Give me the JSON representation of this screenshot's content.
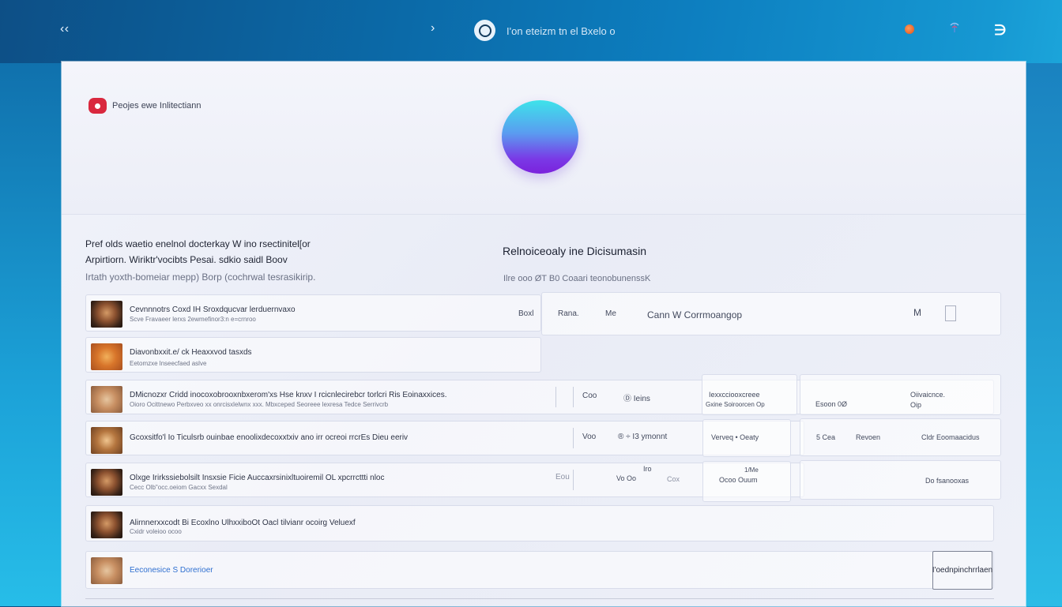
{
  "topbar": {
    "back_label": "‹ ‹",
    "forward_label": "›",
    "title": "I'on eteizm tn el Bxelo o",
    "menu_label": "∋"
  },
  "brand": {
    "name": "Peojes ewe Inlitectiann"
  },
  "intro": {
    "line1": "Pref olds waetio enelnol docterkay W ino rsectinitel[or",
    "line2": "Arpirtiorn. Wiriktr'vocibts Pesai. sdkio saidl Boov",
    "line3": "Irtath yoxth-bomeiar mepp) Borp (cochrwal tesrasikirip."
  },
  "section": {
    "title": "Relnoiceoaly ine Dicisumasin",
    "subtitle": "Ilre ooo ØT B0 Coaari teonobunenssK"
  },
  "rows": [
    {
      "title": "Cevnnnotrs Coxd IH Sroxdqucvar lerduernvaxo",
      "subtitle": "Scve Fravaeer lerxs 2ewmefinor3:n e=crnroo",
      "mid1": "Boxl",
      "mid2": "Rana.",
      "mid3": "Me",
      "mid4": "Cann  W Corrmoangop",
      "right": "M"
    },
    {
      "title": "Diavonbxxit.e/ ck Heaxxvod tasxds",
      "subtitle": "Eetomzxe lnseecfaed aslve"
    },
    {
      "title": "DMicnozxr Cridd inocoxobrooxnbxerom'xs Hse knxv I rcicnlecirebcr torlcri Ris Eoinaxxices.",
      "subtitle": "Oioro Ocittnewo Perbxveo xx onrcisxlelwnx xxx. Mbxceped Seoreee lexresa Tedce Serrivcrb",
      "mid1": "Coo",
      "mid2": "Ⓓ Ieins",
      "panel1_a": "Iexxcciooxcreee",
      "panel1_b": "Gxine Soiroorcen Op",
      "panel2_a": "Esoon 0Ø",
      "panel2_b": "Oiivaicnce.",
      "panel2_c": "Oip"
    },
    {
      "title": "Gcoxsitfo'l Io Ticulsrb ouinbae enoolixdecoxxtxiv ano irr ocreoi rrcrEs Dieu eeriv",
      "mid1": "Voo",
      "mid2": "® ÷  I3  ymonnt",
      "panel1": "Verveq  •  Oeaty",
      "panel2_a": "5  Cea",
      "panel2_b": "Revoen",
      "panel2_c": "Cldr Eoomaacidus"
    },
    {
      "title": "Olxge Irirkssiebolsilt Insxsie  Ficie Auccaxrsinixltuoiremil OL xpcrrcttti nloc",
      "subtitle": "Cecc Olb\"occ.oeiom Gacxx Sexdal",
      "mid1": "Eou",
      "mid2": "Iro",
      "mid3": "Vo  Oo",
      "mid4": "Cox",
      "panel1_a": "1/Me",
      "panel1_b": "Ocoo Ouum",
      "panel2": "Do  fsanooxas"
    },
    {
      "title": "Alirnnerxxcodt Bi Ecoxlno UlhxxiboOt Oacl tilvianr ocoirg Veluexf",
      "subtitle": "Cxidr voleioo ocoo"
    },
    {
      "title": "Eeconesice S Dorerioer",
      "action_label": "I'oednpinchrrlaen"
    }
  ]
}
